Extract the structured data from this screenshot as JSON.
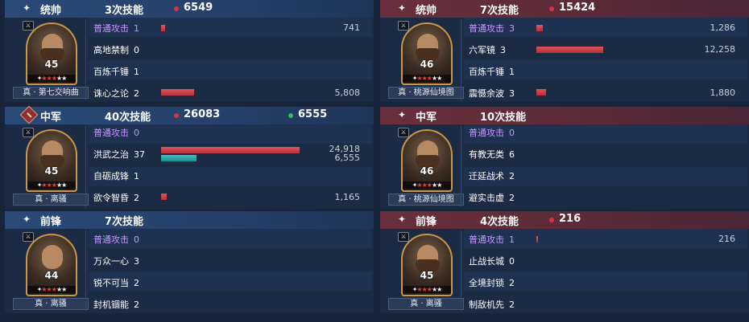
{
  "left": [
    {
      "position": "统帅",
      "header_icon": "sparkle-icon",
      "skill_count": "3次技能",
      "damage": "6549",
      "hero": {
        "level": "45",
        "name": "真 · 第七交响曲"
      },
      "skills": [
        {
          "name": "普通攻击",
          "count": "1",
          "basic": true,
          "bar_ratio": 0.018,
          "value": "741"
        },
        {
          "name": "高地禁制",
          "count": "0"
        },
        {
          "name": "百炼千锤",
          "count": "1"
        },
        {
          "name": "诛心之论",
          "count": "2",
          "bar_ratio": 0.158,
          "value": "5,808"
        }
      ]
    },
    {
      "position": "中军",
      "header_icon": "army-badge-icon",
      "skill_count": "40次技能",
      "damage": "26083",
      "heal": "6555",
      "hero": {
        "level": "45",
        "name": "真 · 离骚"
      },
      "skills": [
        {
          "name": "普通攻击",
          "count": "0",
          "basic": true
        },
        {
          "name": "洪武之治",
          "count": "37",
          "bar_ratio": 0.66,
          "value": "24,918",
          "heal_ratio": 0.17,
          "heal_value": "6,555"
        },
        {
          "name": "自砺成锋",
          "count": "1"
        },
        {
          "name": "欲令智昏",
          "count": "2",
          "bar_ratio": 0.026,
          "value": "1,165"
        }
      ]
    },
    {
      "position": "前锋",
      "header_icon": "sparkle-icon",
      "skill_count": "7次技能",
      "hero": {
        "level": "44",
        "name": "真 · 离骚"
      },
      "skills": [
        {
          "name": "普通攻击",
          "count": "0",
          "basic": true
        },
        {
          "name": "万众一心",
          "count": "3"
        },
        {
          "name": "锐不可当",
          "count": "2"
        },
        {
          "name": "封机锢能",
          "count": "2"
        }
      ]
    }
  ],
  "right": [
    {
      "position": "统帅",
      "header_icon": "sparkle-icon",
      "skill_count": "7次技能",
      "damage": "15424",
      "hero": {
        "level": "46",
        "name": "真 · 桃源仙境图"
      },
      "skills": [
        {
          "name": "普通攻击",
          "count": "3",
          "basic": true,
          "bar_ratio": 0.03,
          "value": "1,286"
        },
        {
          "name": "六军镜",
          "count": "3",
          "bar_ratio": 0.32,
          "value": "12,258"
        },
        {
          "name": "百炼千锤",
          "count": "1"
        },
        {
          "name": "震慑余波",
          "count": "3",
          "bar_ratio": 0.046,
          "value": "1,880"
        }
      ]
    },
    {
      "position": "中军",
      "header_icon": "sparkle-icon",
      "skill_count": "10次技能",
      "hero": {
        "level": "46",
        "name": "真 · 桃源仙境图"
      },
      "skills": [
        {
          "name": "普通攻击",
          "count": "0",
          "basic": true
        },
        {
          "name": "有教无类",
          "count": "6"
        },
        {
          "name": "迁延战术",
          "count": "2"
        },
        {
          "name": "避实击虚",
          "count": "2"
        }
      ]
    },
    {
      "position": "前锋",
      "header_icon": "sparkle-icon",
      "skill_count": "4次技能",
      "damage": "216",
      "hero": {
        "level": "45",
        "name": "真 · 离骚"
      },
      "skills": [
        {
          "name": "普通攻击",
          "count": "1",
          "basic": true,
          "bar_ratio": 0.005,
          "value": "216"
        },
        {
          "name": "止战长城",
          "count": "0"
        },
        {
          "name": "全境封锁",
          "count": "2"
        },
        {
          "name": "制敌机先",
          "count": "2"
        }
      ]
    }
  ],
  "colors": {
    "player_header": "#2a4a78",
    "enemy_header": "#6a2f3c",
    "damage_bar": "#c9404a",
    "heal_bar": "#2aa8a8",
    "basic_skill": "#c59bff",
    "damage_dot": "#d8343c",
    "heal_dot": "#2fbf5f"
  }
}
